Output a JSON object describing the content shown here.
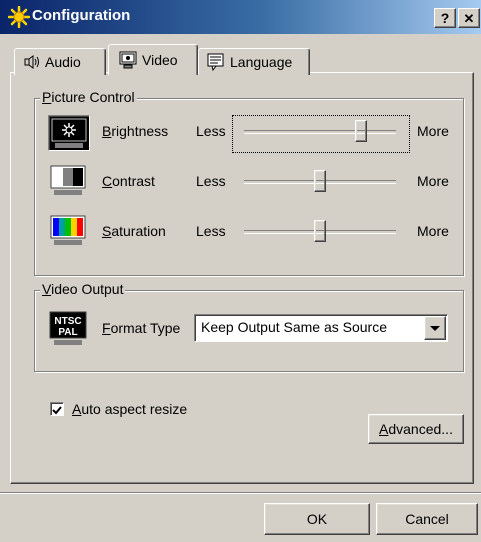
{
  "window": {
    "title": "Configuration",
    "help_glyph": "?",
    "close_glyph": "✕"
  },
  "tabs": [
    {
      "label": "Audio",
      "icon": "speaker-icon"
    },
    {
      "label": "Video",
      "icon": "monitor-icon",
      "selected": true
    },
    {
      "label": "Language",
      "icon": "chat-icon"
    }
  ],
  "picture_control": {
    "title": "Picture Control",
    "less": "Less",
    "more": "More",
    "rows": [
      {
        "label": "Brightness",
        "level": 0.77,
        "focused": true
      },
      {
        "label": "Contrast",
        "level": 0.5
      },
      {
        "label": "Saturation",
        "level": 0.5
      }
    ]
  },
  "video_output": {
    "title": "Video Output",
    "format_label": "Format Type",
    "format_value": "Keep Output Same as Source",
    "icon_text_top": "NTSC",
    "icon_text_bottom": "PAL"
  },
  "auto_aspect": {
    "label": "Auto aspect resize",
    "checked": true
  },
  "buttons": {
    "advanced": "Advanced...",
    "ok": "OK",
    "cancel": "Cancel"
  },
  "colors": {
    "dialog": "#d4d0c8",
    "title_start": "#0a246a",
    "title_end": "#a6caf0"
  }
}
